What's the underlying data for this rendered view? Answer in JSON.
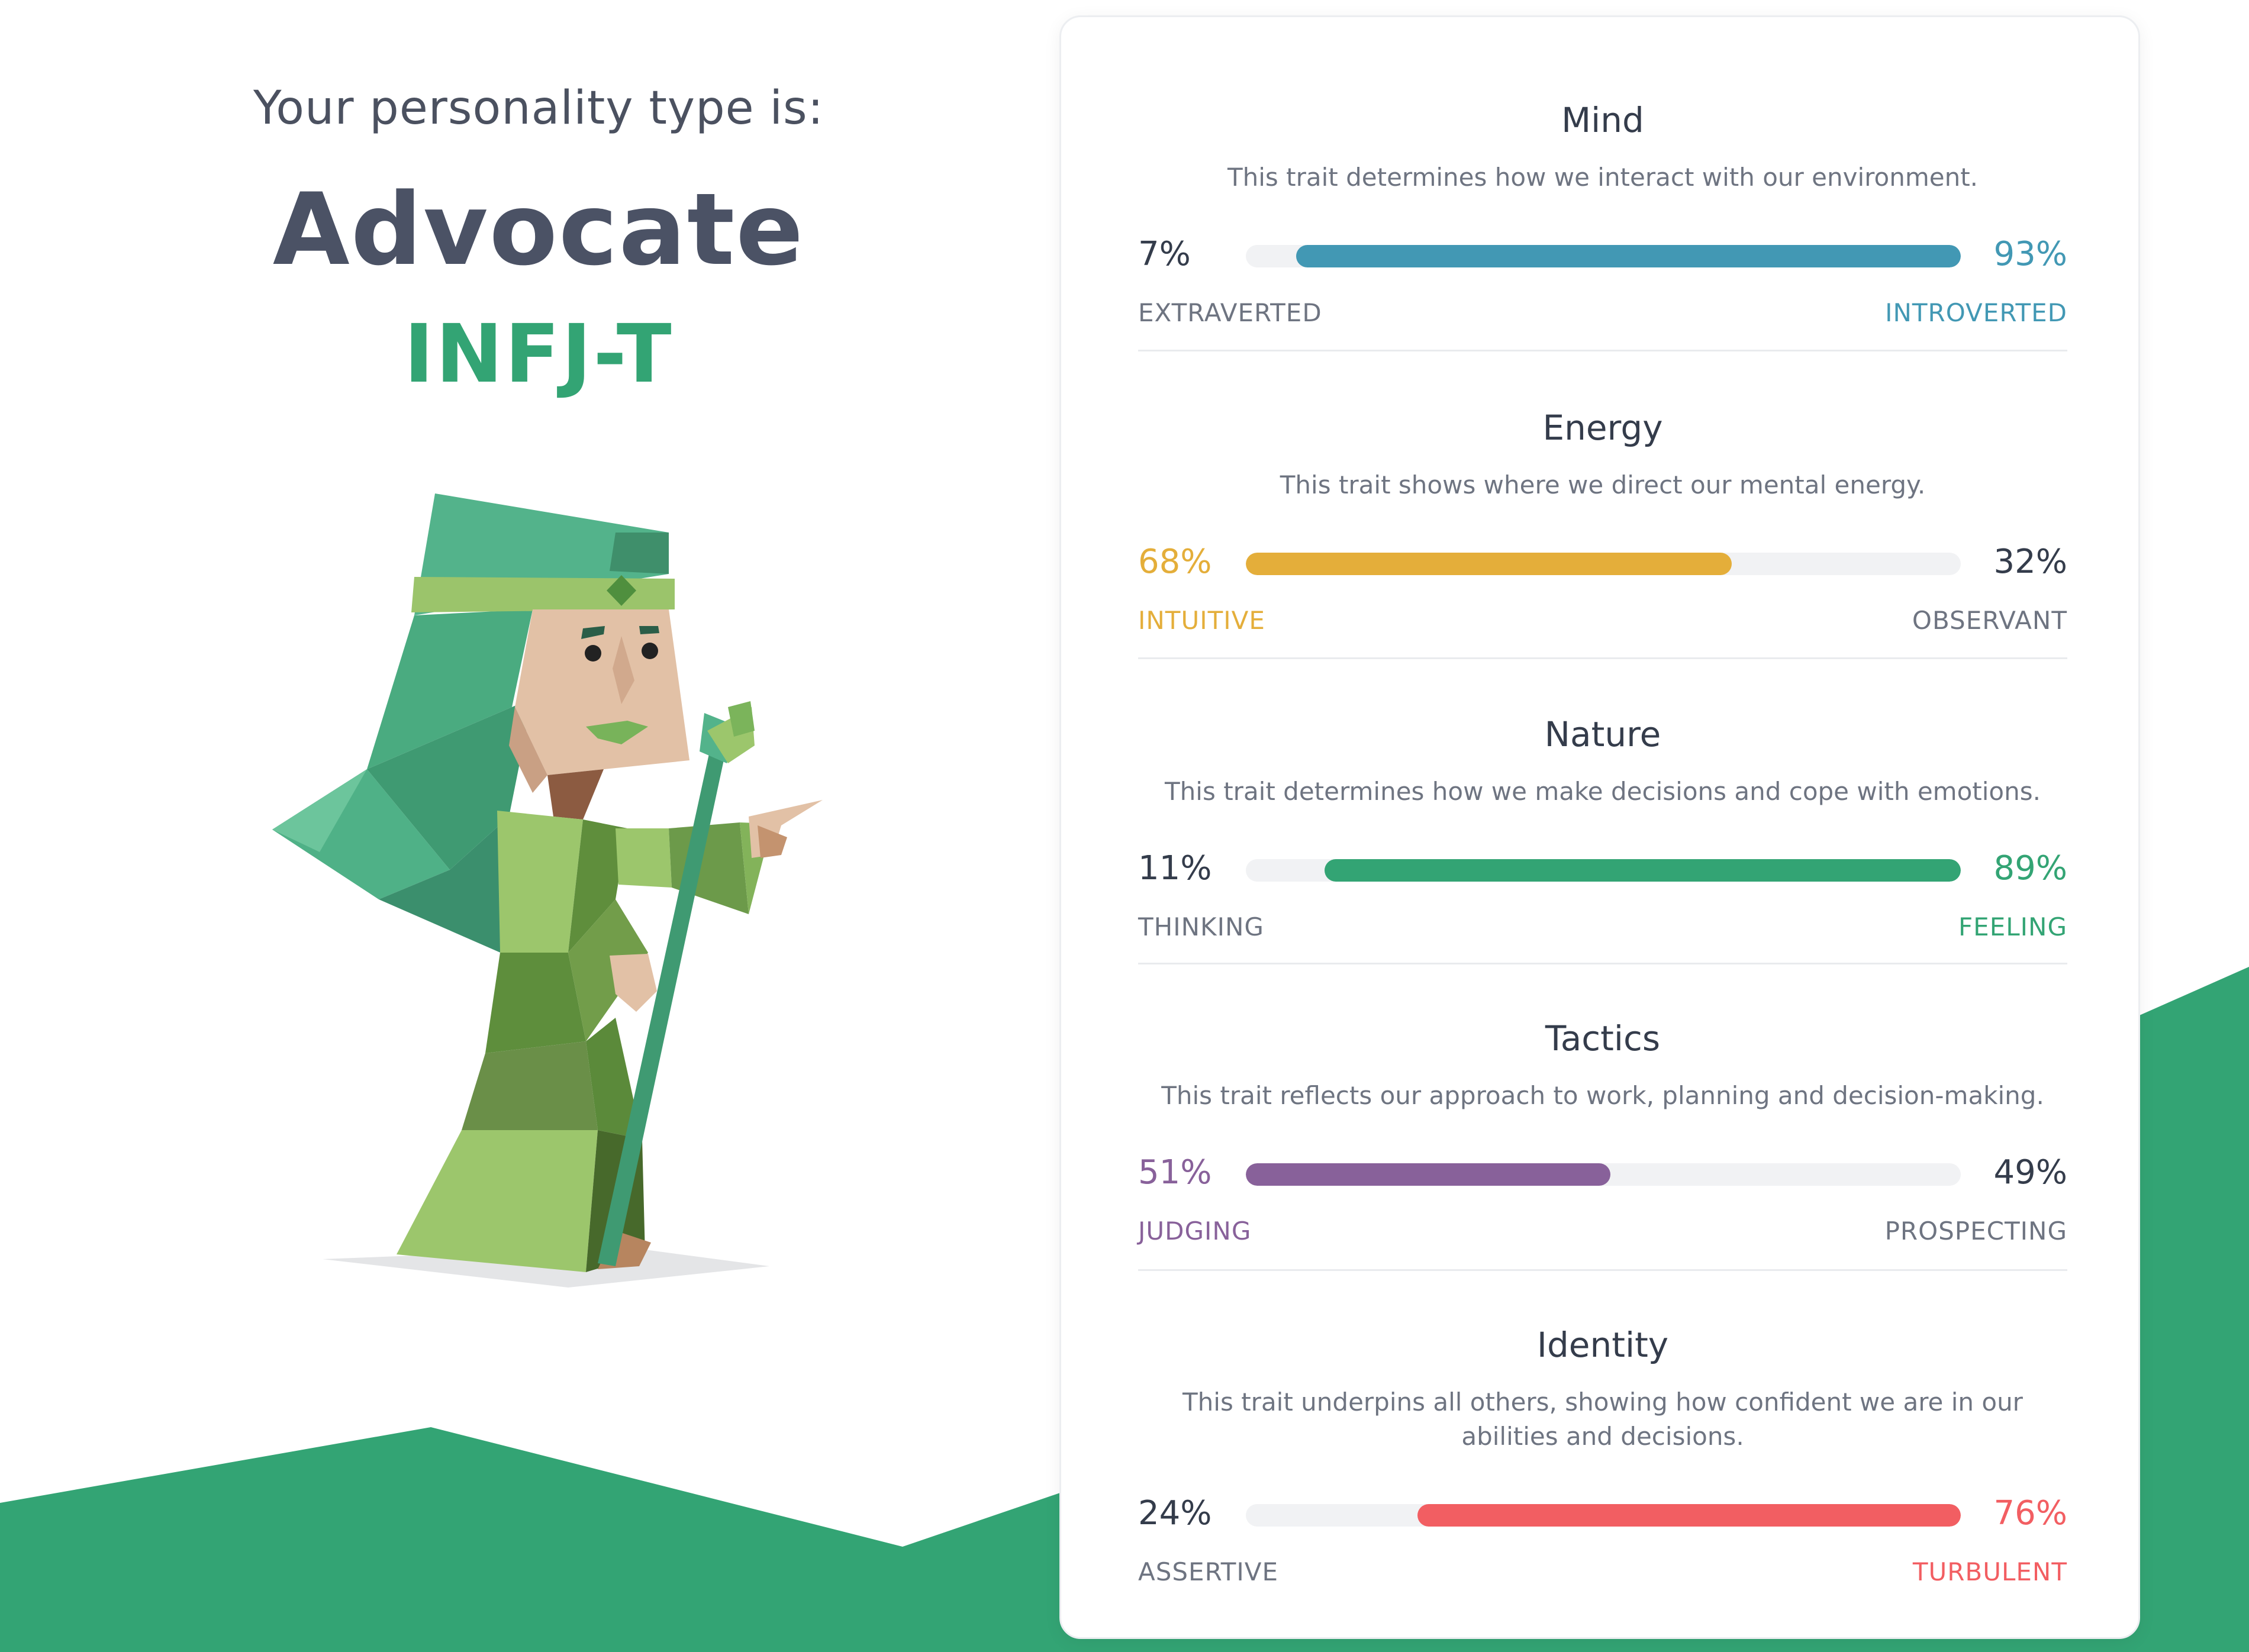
{
  "header": {
    "intro": "Your personality type is:",
    "type_name": "Advocate",
    "type_code": "INFJ-T"
  },
  "colors": {
    "green": "#33a474",
    "blue": "#4298b4",
    "yellow": "#e4ae3a",
    "purple": "#88619a",
    "red": "#f25e62",
    "text_dark": "#343c4b",
    "text_muted": "#6e7481"
  },
  "traits": [
    {
      "title": "Mind",
      "description": "This trait determines how we interact with our environment.",
      "left_percent": "7%",
      "right_percent": "93%",
      "left_label": "EXTRAVERTED",
      "right_label": "INTROVERTED",
      "dominant": "right",
      "value": 93,
      "color": "#4298b4"
    },
    {
      "title": "Energy",
      "description": "This trait shows where we direct our mental energy.",
      "left_percent": "68%",
      "right_percent": "32%",
      "left_label": "INTUITIVE",
      "right_label": "OBSERVANT",
      "dominant": "left",
      "value": 68,
      "color": "#e4ae3a"
    },
    {
      "title": "Nature",
      "description": "This trait determines how we make decisions and cope with emotions.",
      "left_percent": "11%",
      "right_percent": "89%",
      "left_label": "THINKING",
      "right_label": "FEELING",
      "dominant": "right",
      "value": 89,
      "color": "#33a474"
    },
    {
      "title": "Tactics",
      "description": "This trait reflects our approach to work, planning and decision-making.",
      "left_percent": "51%",
      "right_percent": "49%",
      "left_label": "JUDGING",
      "right_label": "PROSPECTING",
      "dominant": "left",
      "value": 51,
      "color": "#88619a"
    },
    {
      "title": "Identity",
      "description": "This trait underpins all others, showing how confident we are in our abilities and decisions.",
      "left_percent": "24%",
      "right_percent": "76%",
      "left_label": "ASSERTIVE",
      "right_label": "TURBULENT",
      "dominant": "right",
      "value": 76,
      "color": "#f25e62"
    }
  ]
}
